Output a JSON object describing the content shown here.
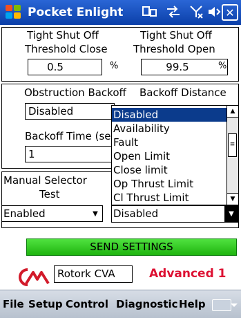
{
  "titlebar": {
    "title": "Pocket Enlight",
    "icons": [
      "connectivity-icon",
      "sync-icon",
      "signal-off-icon",
      "volume-icon"
    ],
    "close_label": "✕"
  },
  "threshold": {
    "close_label_1": "Tight Shut Off",
    "close_label_2": "Threshold Close",
    "close_value": "0.5",
    "close_unit": "%",
    "open_label_1": "Tight Shut Off",
    "open_label_2": "Threshold Open",
    "open_value": "99.5",
    "open_unit": "%"
  },
  "obstruction": {
    "backoff_label": "Obstruction Backoff",
    "backoff_value": "Disabled",
    "distance_label": "Backoff Distance",
    "time_label": "Backoff Time (se",
    "time_value": "1"
  },
  "dropdown": {
    "items": [
      "Disabled",
      "Availability",
      "Fault",
      "Open Limit",
      "Close limit",
      "Op Thrust Limit",
      "Cl Thrust Limit"
    ],
    "selected": "Disabled"
  },
  "manual": {
    "label_1": "Manual Selector",
    "label_2": "Test",
    "value": "Enabled",
    "relay_value": "Disabled"
  },
  "send_label": "SEND SETTINGS",
  "brand": {
    "name": "Rotork CVA",
    "mode": "Advanced 1"
  },
  "menu": [
    "File",
    "Setup",
    "Control",
    "Diagnostic",
    "Help"
  ],
  "colors": {
    "titlebar": "#1450c0",
    "selection": "#0b3b8c",
    "send_button": "#33cc22",
    "mode_text": "#dd1133"
  }
}
